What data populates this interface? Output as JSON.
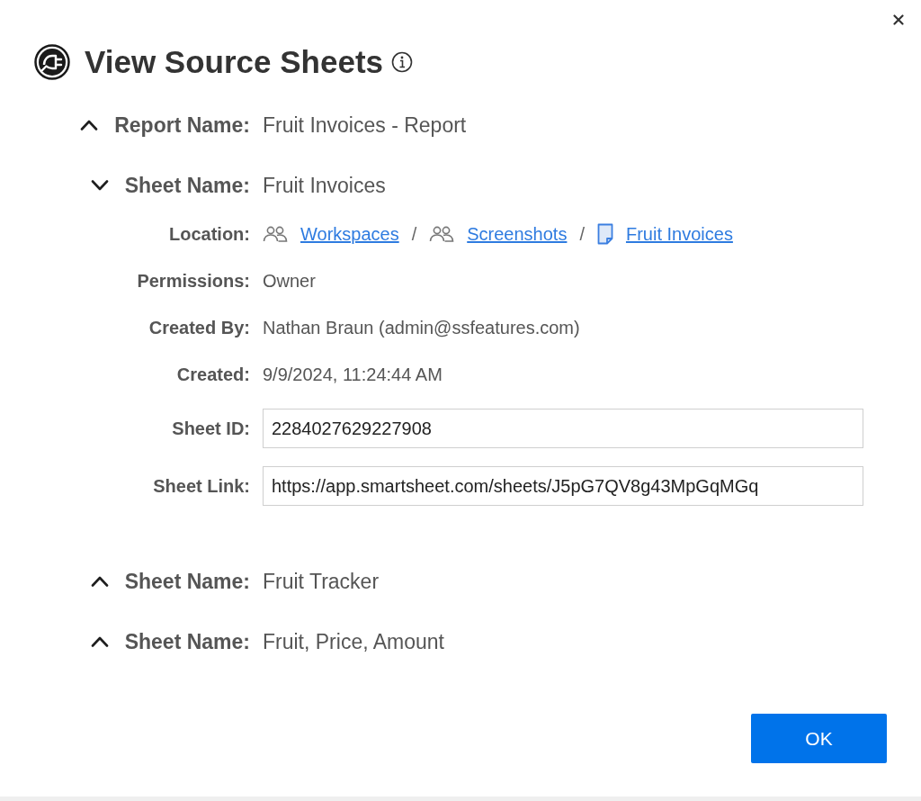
{
  "dialog": {
    "title": "View Source Sheets"
  },
  "report": {
    "label": "Report Name:",
    "value": "Fruit Invoices - Report",
    "expanded": true
  },
  "sheets": [
    {
      "label": "Sheet Name:",
      "value": "Fruit Invoices",
      "expanded": true,
      "details": [
        {
          "kind": "path",
          "label": "Location:",
          "path": [
            {
              "kind": "workspace",
              "text": "Workspaces"
            },
            {
              "kind": "separator",
              "text": "/"
            },
            {
              "kind": "workspace",
              "text": "Screenshots"
            },
            {
              "kind": "separator",
              "text": "/"
            },
            {
              "kind": "sheet",
              "text": "Fruit Invoices"
            }
          ]
        },
        {
          "kind": "text",
          "label": "Permissions:",
          "value": "Owner"
        },
        {
          "kind": "text",
          "label": "Created By:",
          "value": "Nathan Braun (admin@ssfeatures.com)"
        },
        {
          "kind": "text",
          "label": "Created:",
          "value": "9/9/2024, 11:24:44 AM"
        },
        {
          "kind": "field",
          "label": "Sheet ID:",
          "value": "2284027629227908"
        },
        {
          "kind": "field",
          "label": "Sheet Link:",
          "value": "https://app.smartsheet.com/sheets/J5pG7QV8g43MpGqMGq"
        }
      ]
    },
    {
      "label": "Sheet Name:",
      "value": "Fruit Tracker",
      "expanded": false
    },
    {
      "label": "Sheet Name:",
      "value": "Fruit, Price, Amount",
      "expanded": false
    }
  ],
  "buttons": [
    {
      "label": "OK"
    }
  ]
}
